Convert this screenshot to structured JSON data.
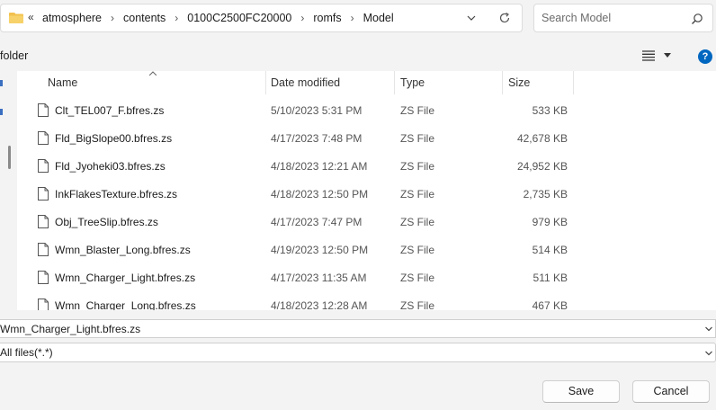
{
  "breadcrumb": {
    "overflow": "«",
    "items": [
      "atmosphere",
      "contents",
      "0100C2500FC20000",
      "romfs",
      "Model"
    ],
    "separator": "›"
  },
  "search": {
    "placeholder": "Search Model"
  },
  "toolbar": {
    "folder_label": "folder",
    "help_label": "?"
  },
  "columns": {
    "name": "Name",
    "date": "Date modified",
    "type": "Type",
    "size": "Size"
  },
  "files": [
    {
      "name": "Clt_TEL007_F.bfres.zs",
      "date": "5/10/2023 5:31 PM",
      "type": "ZS File",
      "size": "533 KB"
    },
    {
      "name": "Fld_BigSlope00.bfres.zs",
      "date": "4/17/2023 7:48 PM",
      "type": "ZS File",
      "size": "42,678 KB"
    },
    {
      "name": "Fld_Jyoheki03.bfres.zs",
      "date": "4/18/2023 12:21 AM",
      "type": "ZS File",
      "size": "24,952 KB"
    },
    {
      "name": "InkFlakesTexture.bfres.zs",
      "date": "4/18/2023 12:50 PM",
      "type": "ZS File",
      "size": "2,735 KB"
    },
    {
      "name": "Obj_TreeSlip.bfres.zs",
      "date": "4/17/2023 7:47 PM",
      "type": "ZS File",
      "size": "979 KB"
    },
    {
      "name": "Wmn_Blaster_Long.bfres.zs",
      "date": "4/19/2023 12:50 PM",
      "type": "ZS File",
      "size": "514 KB"
    },
    {
      "name": "Wmn_Charger_Light.bfres.zs",
      "date": "4/17/2023 11:35 AM",
      "type": "ZS File",
      "size": "511 KB"
    },
    {
      "name": "Wmn_Charger_Long.bfres.zs",
      "date": "4/18/2023 12:28 AM",
      "type": "ZS File",
      "size": "467 KB"
    }
  ],
  "filename_field": {
    "value": "Wmn_Charger_Light.bfres.zs"
  },
  "filetype_field": {
    "value": "All files(*.*)"
  },
  "buttons": {
    "save": "Save",
    "cancel": "Cancel"
  },
  "colors": {
    "accent": "#0067c0",
    "folder": "#f2c14e"
  }
}
